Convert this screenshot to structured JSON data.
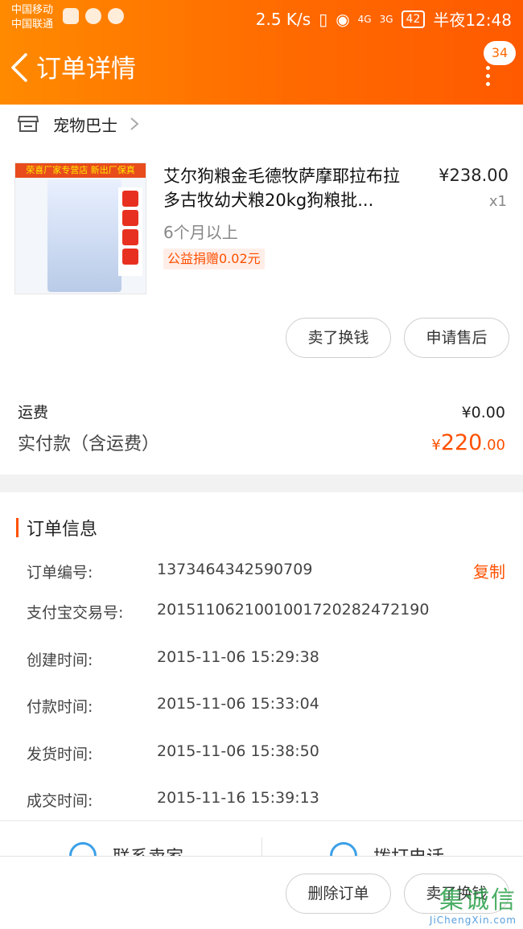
{
  "status_bar": {
    "carrier_1": "中国移动",
    "carrier_2": "中国联通",
    "speed": "2.5 K/s",
    "net_1": "4G",
    "net_2": "3G",
    "battery": "42",
    "time": "半夜12:48"
  },
  "header": {
    "title": "订单详情",
    "badge_count": "34"
  },
  "shop": {
    "name": "宠物巴士"
  },
  "product": {
    "title": "艾尔狗粮金毛德牧萨摩耶拉布拉多古牧幼犬粮20kg狗粮批...",
    "price": "¥238.00",
    "quantity": "x1",
    "sku": "6个月以上",
    "charity": "公益捐赠0.02元",
    "image_banner": "荣喜厂家专营店 新出厂保真",
    "image_sale": "全国包邮"
  },
  "actions": {
    "sell_label": "卖了换钱",
    "after_sale_label": "申请售后"
  },
  "summary": {
    "shipping_label": "运费",
    "shipping_value": "¥0.00",
    "paid_label": "实付款（含运费）",
    "paid_currency": "¥",
    "paid_int": "220",
    "paid_dec": ".00"
  },
  "order_info": {
    "title": "订单信息",
    "copy_label": "复制",
    "rows": [
      {
        "label": "订单编号:",
        "value": "1373464342590709"
      },
      {
        "label": "支付宝交易号:",
        "value": "2015110621001001720282472190"
      },
      {
        "label": "创建时间:",
        "value": "2015-11-06 15:29:38"
      },
      {
        "label": "付款时间:",
        "value": "2015-11-06 15:33:04"
      },
      {
        "label": "发货时间:",
        "value": "2015-11-06 15:38:50"
      },
      {
        "label": "成交时间:",
        "value": "2015-11-16 15:39:13"
      }
    ]
  },
  "contact": {
    "seller_label": "联系卖家",
    "phone_label": "拨打电话"
  },
  "bottom_bar": {
    "delete_label": "删除订单",
    "sell_label": "卖了换钱"
  },
  "watermark": {
    "logo": "集诚信",
    "url": "JiChengXin.com"
  },
  "colors": {
    "accent": "#ff5000",
    "header_start": "#ff8a00",
    "header_end": "#ff5a00"
  }
}
